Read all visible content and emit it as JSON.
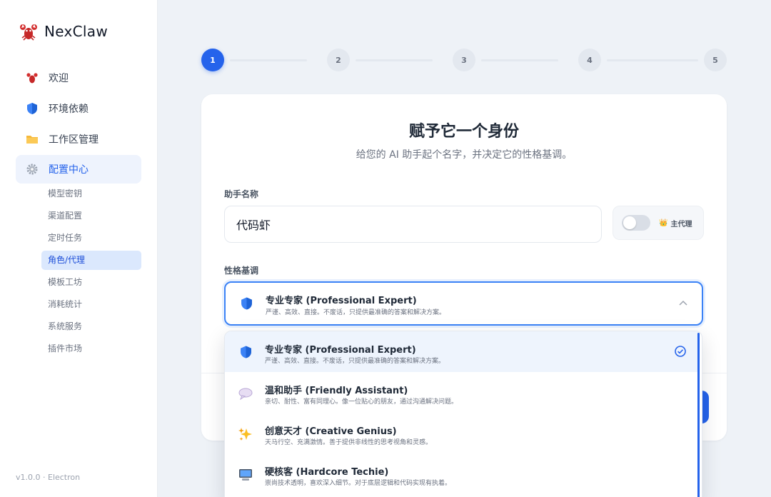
{
  "app": {
    "name": "NexClaw",
    "version": "v1.0.0 · Electron"
  },
  "sidebar": {
    "items": [
      {
        "label": "欢迎",
        "icon": "lobster-icon"
      },
      {
        "label": "环境依赖",
        "icon": "shield-icon"
      },
      {
        "label": "工作区管理",
        "icon": "folder-icon"
      },
      {
        "label": "配置中心",
        "icon": "gear-icon",
        "active": true
      }
    ],
    "subitems": [
      {
        "label": "模型密钥"
      },
      {
        "label": "渠道配置"
      },
      {
        "label": "定时任务"
      },
      {
        "label": "角色/代理",
        "active": true
      },
      {
        "label": "模板工坊"
      },
      {
        "label": "消耗统计"
      },
      {
        "label": "系统服务"
      },
      {
        "label": "插件市场"
      }
    ]
  },
  "stepper": {
    "steps": [
      "1",
      "2",
      "3",
      "4",
      "5"
    ],
    "current": 1
  },
  "card": {
    "title": "赋予它一个身份",
    "subtitle": "给您的 AI 助手起个名字，并决定它的性格基调。",
    "name_label": "助手名称",
    "name_value": "代码虾",
    "main_agent_label": "主代理",
    "main_agent_enabled": false,
    "personality_label": "性格基调"
  },
  "select": {
    "selected_title": "专业专家 (Professional Expert)",
    "selected_desc": "严谨、高效、直接。不废话，只提供最准确的答案和解决方案。",
    "options": [
      {
        "title": "专业专家 (Professional Expert)",
        "desc": "严谨、高效、直接。不废话，只提供最准确的答案和解决方案。",
        "icon": "shield-icon",
        "selected": true
      },
      {
        "title": "温和助手 (Friendly Assistant)",
        "desc": "亲切、耐性、富有同理心。像一位贴心的朋友，通过沟通解决问题。",
        "icon": "speech-bubble-icon"
      },
      {
        "title": "创意天才 (Creative Genius)",
        "desc": "天马行空、充满激情。善于提供非线性的思考视角和灵感。",
        "icon": "sparkles-icon"
      },
      {
        "title": "硬核客 (Hardcore Techie)",
        "desc": "崇尚技术透明，喜欢深入细节。对于底层逻辑和代码实现有执着。",
        "icon": "computer-icon"
      }
    ]
  },
  "colors": {
    "accent": "#2563eb",
    "sidebar_active_bg": "#eef3fd",
    "subitem_active_bg": "#dbe8fd",
    "page_bg": "#eef2f7"
  }
}
